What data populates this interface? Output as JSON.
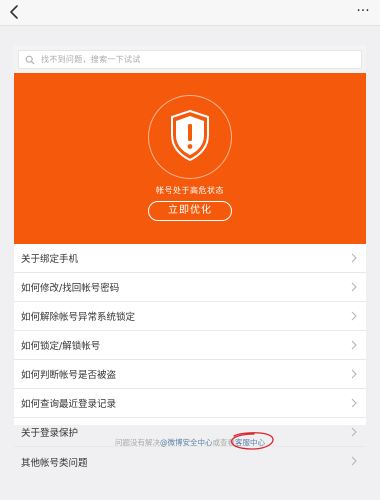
{
  "search": {
    "placeholder": "找不到问题，搜索一下试试"
  },
  "hero": {
    "status": "帐号处于高危状态",
    "button": "立即优化",
    "color": "#f55a0c"
  },
  "menu": {
    "items": [
      {
        "label": "关于绑定手机"
      },
      {
        "label": "如何修改/找回帐号密码"
      },
      {
        "label": "如何解除帐号异常系统锁定"
      },
      {
        "label": "如何锁定/解锁帐号"
      },
      {
        "label": "如何判断帐号是否被盗"
      },
      {
        "label": "如何查询最近登录记录"
      },
      {
        "label": "关于登录保护"
      },
      {
        "label": "其他帐号类问题"
      }
    ]
  },
  "footer": {
    "prefix": "问题没有解决",
    "link1": "@微博安全中心",
    "middle": "或查看",
    "link2": "客服中心"
  },
  "icons": {
    "back": "back-chevron-icon",
    "more": "more-dots-icon",
    "search": "search-icon",
    "shield": "shield-alert-icon",
    "chevron": "chevron-right-icon"
  }
}
